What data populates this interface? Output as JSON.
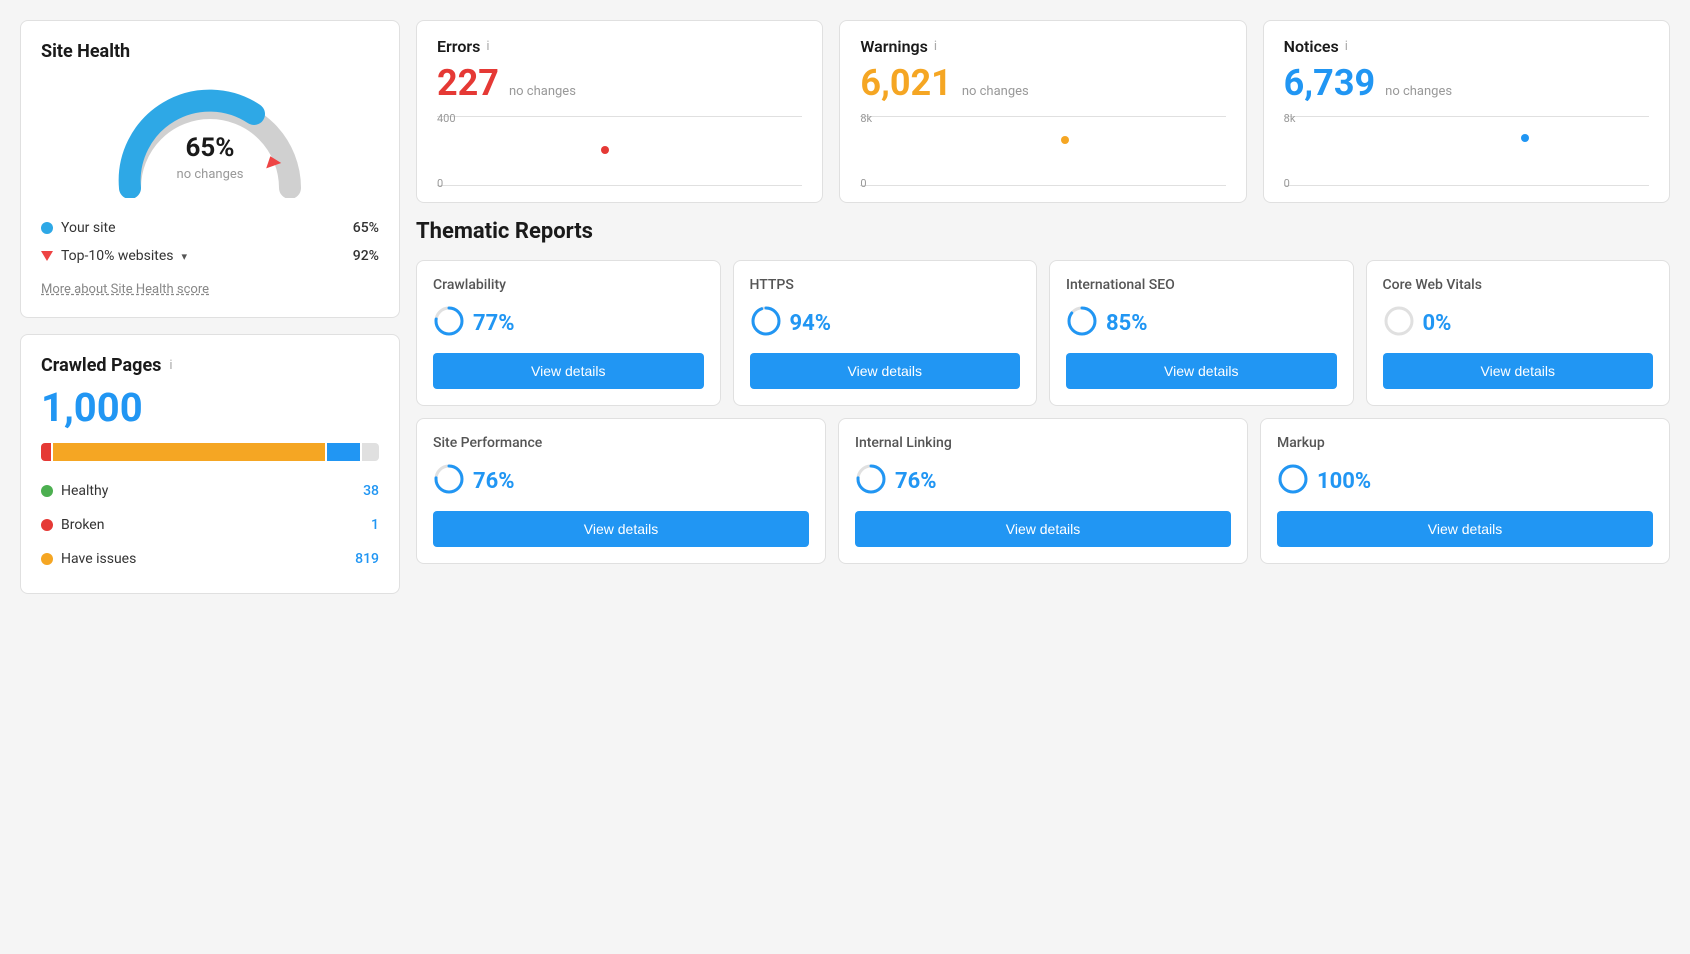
{
  "site_health": {
    "title": "Site Health",
    "percent": "65%",
    "no_changes": "no changes",
    "your_site_label": "Your site",
    "your_site_value": "65%",
    "top10_label": "Top-10% websites",
    "top10_value": "92%",
    "more_link": "More about Site Health score"
  },
  "crawled_pages": {
    "title": "Crawled Pages",
    "info_icon": "i",
    "total": "1,000",
    "legend": [
      {
        "label": "Healthy",
        "value": "38",
        "color": "green"
      },
      {
        "label": "Broken",
        "value": "1",
        "color": "red"
      },
      {
        "label": "Have issues",
        "value": "819",
        "color": "orange"
      }
    ]
  },
  "errors": {
    "label": "Errors",
    "info_icon": "i",
    "value": "227",
    "no_changes": "no changes",
    "chart_top": "400",
    "chart_bottom": "0"
  },
  "warnings": {
    "label": "Warnings",
    "info_icon": "i",
    "value": "6,021",
    "no_changes": "no changes",
    "chart_top": "8k",
    "chart_bottom": "0"
  },
  "notices": {
    "label": "Notices",
    "info_icon": "i",
    "value": "6,739",
    "no_changes": "no changes",
    "chart_top": "8k",
    "chart_bottom": "0"
  },
  "thematic_reports": {
    "title": "Thematic Reports",
    "view_details_label": "View details",
    "top_row": [
      {
        "name": "Crawlability",
        "score": "77%",
        "color": "#2196f3",
        "pct": 77
      },
      {
        "name": "HTTPS",
        "score": "94%",
        "color": "#2196f3",
        "pct": 94
      },
      {
        "name": "International SEO",
        "score": "85%",
        "color": "#2196f3",
        "pct": 85
      },
      {
        "name": "Core Web Vitals",
        "score": "0%",
        "color": "#ccc",
        "pct": 0
      }
    ],
    "bottom_row": [
      {
        "name": "Site Performance",
        "score": "76%",
        "color": "#2196f3",
        "pct": 76
      },
      {
        "name": "Internal Linking",
        "score": "76%",
        "color": "#2196f3",
        "pct": 76
      },
      {
        "name": "Markup",
        "score": "100%",
        "color": "#2196f3",
        "pct": 100
      }
    ]
  }
}
